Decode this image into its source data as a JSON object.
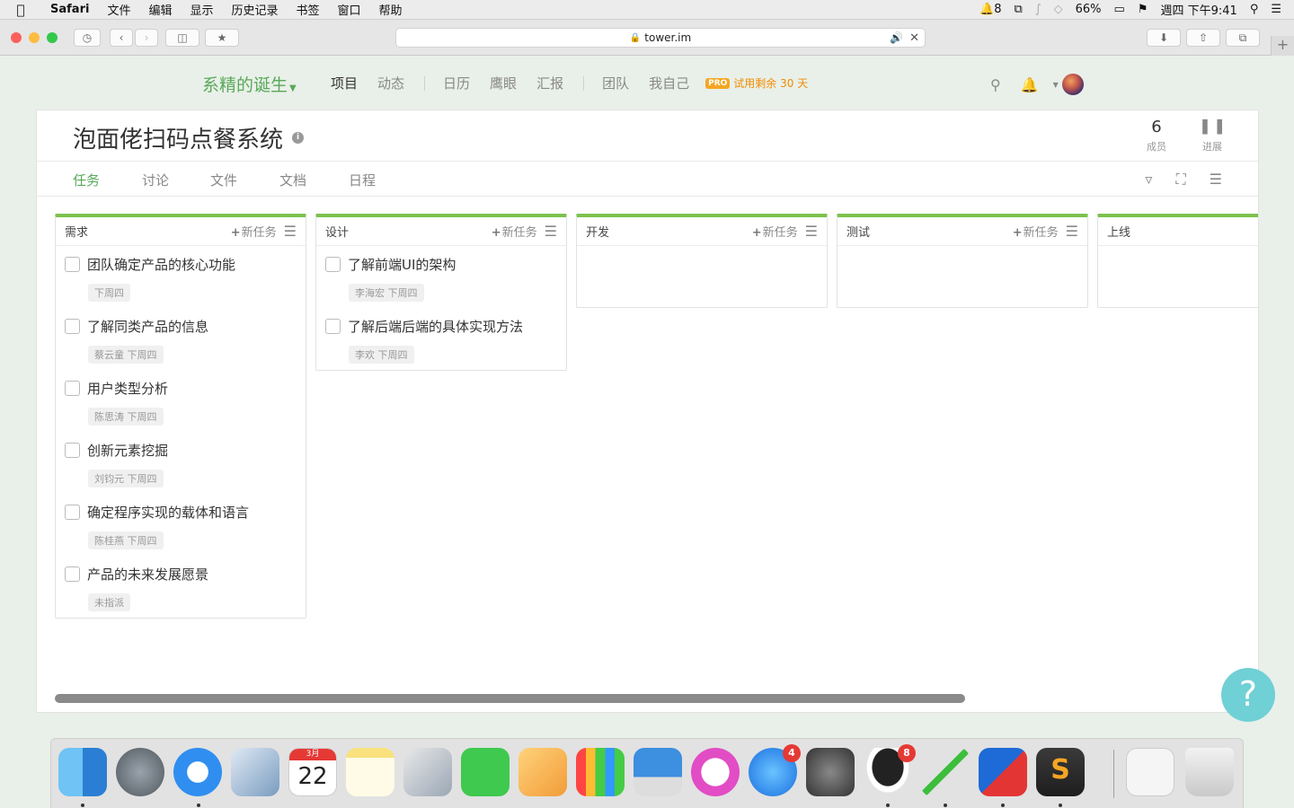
{
  "menubar": {
    "app": "Safari",
    "items": [
      "文件",
      "编辑",
      "显示",
      "历史记录",
      "书签",
      "窗口",
      "帮助"
    ],
    "notif_count": "8",
    "battery": "66%",
    "clock": "週四 下午9:41"
  },
  "browser": {
    "url": "tower.im"
  },
  "header": {
    "team_name": "系精的诞生",
    "nav": [
      "项目",
      "动态",
      "日历",
      "鹰眼",
      "汇报",
      "团队",
      "我自己"
    ],
    "pro_tag": "PRO",
    "trial_text": "试用剩余 30 天"
  },
  "project": {
    "title": "泡面佬扫码点餐系统",
    "info_icon": "i",
    "members_count": "6",
    "members_label": "成员",
    "progress_label": "进展",
    "tabs": [
      "任务",
      "讨论",
      "文件",
      "文档",
      "日程"
    ]
  },
  "board": {
    "new_task_label": "新任务",
    "columns": [
      {
        "name": "需求",
        "tasks": [
          {
            "title": "团队确定产品的核心功能",
            "meta": "下周四"
          },
          {
            "title": "了解同类产品的信息",
            "meta": "蔡云童 下周四"
          },
          {
            "title": "用户类型分析",
            "meta": "陈思涛 下周四"
          },
          {
            "title": "创新元素挖掘",
            "meta": "刘钧元 下周四"
          },
          {
            "title": "确定程序实现的载体和语言",
            "meta": "陈桂燕 下周四"
          },
          {
            "title": "产品的未来发展愿景",
            "meta": "未指派"
          }
        ]
      },
      {
        "name": "设计",
        "tasks": [
          {
            "title": "了解前端UI的架构",
            "meta": "李海宏 下周四"
          },
          {
            "title": "了解后端后端的具体实现方法",
            "meta": "李欢 下周四"
          }
        ]
      },
      {
        "name": "开发",
        "tasks": []
      },
      {
        "name": "测试",
        "tasks": []
      },
      {
        "name": "上线",
        "tasks": []
      }
    ]
  },
  "scroll": {
    "horizontal_position_pct": 0,
    "visible_fraction": 0.756
  },
  "help_button": "?",
  "dock": {
    "apps": [
      "finder",
      "launchpad",
      "safari",
      "preview",
      "calendar",
      "notes",
      "photo-booth",
      "facetime",
      "pages",
      "numbers",
      "keynote",
      "itunes",
      "app-store",
      "system-preferences",
      "qq",
      "sourcetree",
      "vmware",
      "sublime-text",
      "screenshot",
      "trash"
    ],
    "calendar_month": "3月",
    "calendar_day": "22",
    "app_store_badge": "4",
    "qq_badge": "8"
  },
  "colors": {
    "accent_green": "#59a859",
    "column_top": "#7cc14d",
    "trial_orange": "#f08c00",
    "help_teal": "#6fd0d6"
  }
}
